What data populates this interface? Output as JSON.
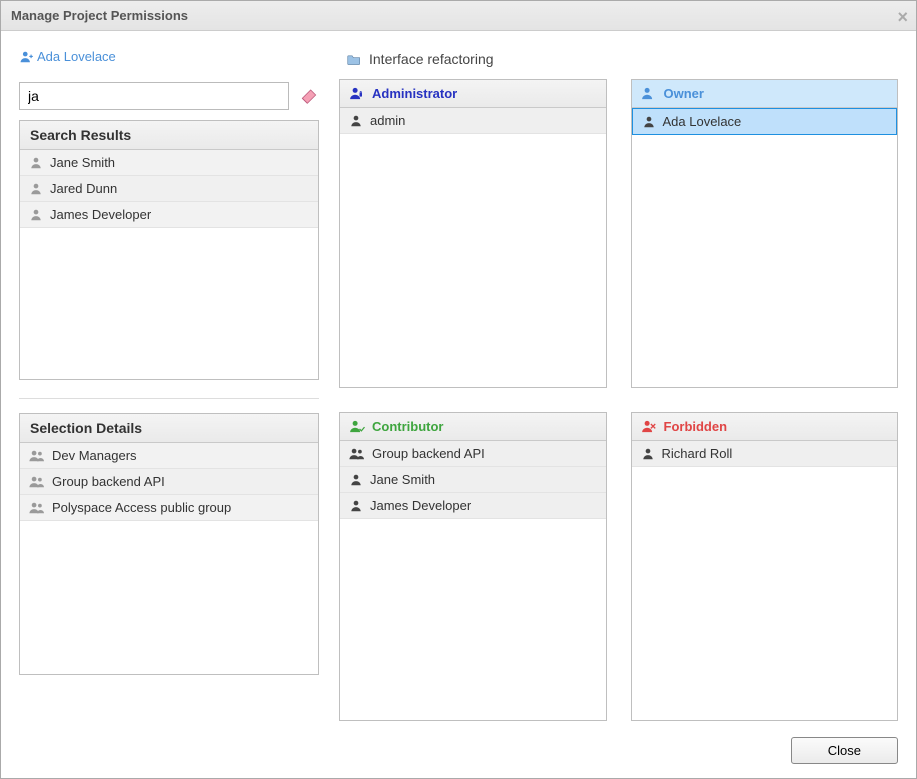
{
  "dialog": {
    "title": "Manage Project Permissions",
    "close_label": "Close"
  },
  "current_user": "Ada Lovelace",
  "search": {
    "value": "ja",
    "results_header": "Search Results",
    "results": [
      "Jane Smith",
      "Jared Dunn",
      "James Developer"
    ]
  },
  "selection": {
    "header": "Selection Details",
    "items": [
      {
        "label": "Dev Managers",
        "type": "group"
      },
      {
        "label": "Group backend API",
        "type": "group"
      },
      {
        "label": "Polyspace Access public group",
        "type": "group"
      }
    ]
  },
  "project": {
    "name": "Interface refactoring"
  },
  "roles": {
    "administrator": {
      "label": "Administrator",
      "members": [
        {
          "label": "admin",
          "type": "user"
        }
      ]
    },
    "owner": {
      "label": "Owner",
      "members": [
        {
          "label": "Ada Lovelace",
          "type": "user",
          "selected": true
        }
      ]
    },
    "contributor": {
      "label": "Contributor",
      "members": [
        {
          "label": "Group backend API",
          "type": "group"
        },
        {
          "label": "Jane Smith",
          "type": "user"
        },
        {
          "label": "James Developer",
          "type": "user"
        }
      ]
    },
    "forbidden": {
      "label": "Forbidden",
      "members": [
        {
          "label": "Richard Roll",
          "type": "user"
        }
      ]
    }
  }
}
